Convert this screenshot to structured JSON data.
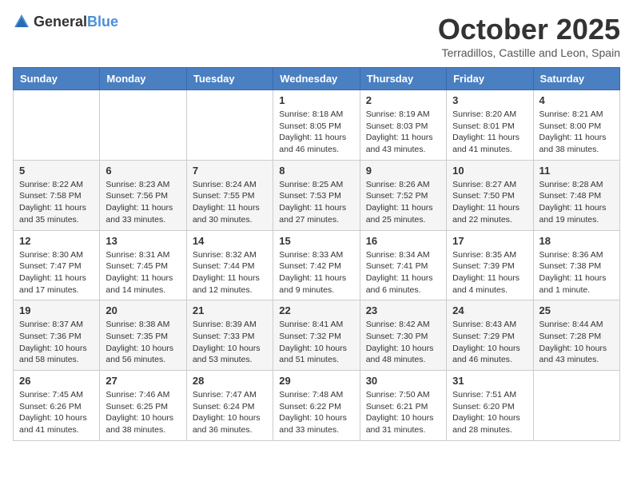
{
  "header": {
    "logo_general": "General",
    "logo_blue": "Blue",
    "month_title": "October 2025",
    "location": "Terradillos, Castille and Leon, Spain"
  },
  "weekdays": [
    "Sunday",
    "Monday",
    "Tuesday",
    "Wednesday",
    "Thursday",
    "Friday",
    "Saturday"
  ],
  "weeks": [
    [
      {
        "day": "",
        "sunrise": "",
        "sunset": "",
        "daylight": ""
      },
      {
        "day": "",
        "sunrise": "",
        "sunset": "",
        "daylight": ""
      },
      {
        "day": "",
        "sunrise": "",
        "sunset": "",
        "daylight": ""
      },
      {
        "day": "1",
        "sunrise": "Sunrise: 8:18 AM",
        "sunset": "Sunset: 8:05 PM",
        "daylight": "Daylight: 11 hours and 46 minutes."
      },
      {
        "day": "2",
        "sunrise": "Sunrise: 8:19 AM",
        "sunset": "Sunset: 8:03 PM",
        "daylight": "Daylight: 11 hours and 43 minutes."
      },
      {
        "day": "3",
        "sunrise": "Sunrise: 8:20 AM",
        "sunset": "Sunset: 8:01 PM",
        "daylight": "Daylight: 11 hours and 41 minutes."
      },
      {
        "day": "4",
        "sunrise": "Sunrise: 8:21 AM",
        "sunset": "Sunset: 8:00 PM",
        "daylight": "Daylight: 11 hours and 38 minutes."
      }
    ],
    [
      {
        "day": "5",
        "sunrise": "Sunrise: 8:22 AM",
        "sunset": "Sunset: 7:58 PM",
        "daylight": "Daylight: 11 hours and 35 minutes."
      },
      {
        "day": "6",
        "sunrise": "Sunrise: 8:23 AM",
        "sunset": "Sunset: 7:56 PM",
        "daylight": "Daylight: 11 hours and 33 minutes."
      },
      {
        "day": "7",
        "sunrise": "Sunrise: 8:24 AM",
        "sunset": "Sunset: 7:55 PM",
        "daylight": "Daylight: 11 hours and 30 minutes."
      },
      {
        "day": "8",
        "sunrise": "Sunrise: 8:25 AM",
        "sunset": "Sunset: 7:53 PM",
        "daylight": "Daylight: 11 hours and 27 minutes."
      },
      {
        "day": "9",
        "sunrise": "Sunrise: 8:26 AM",
        "sunset": "Sunset: 7:52 PM",
        "daylight": "Daylight: 11 hours and 25 minutes."
      },
      {
        "day": "10",
        "sunrise": "Sunrise: 8:27 AM",
        "sunset": "Sunset: 7:50 PM",
        "daylight": "Daylight: 11 hours and 22 minutes."
      },
      {
        "day": "11",
        "sunrise": "Sunrise: 8:28 AM",
        "sunset": "Sunset: 7:48 PM",
        "daylight": "Daylight: 11 hours and 19 minutes."
      }
    ],
    [
      {
        "day": "12",
        "sunrise": "Sunrise: 8:30 AM",
        "sunset": "Sunset: 7:47 PM",
        "daylight": "Daylight: 11 hours and 17 minutes."
      },
      {
        "day": "13",
        "sunrise": "Sunrise: 8:31 AM",
        "sunset": "Sunset: 7:45 PM",
        "daylight": "Daylight: 11 hours and 14 minutes."
      },
      {
        "day": "14",
        "sunrise": "Sunrise: 8:32 AM",
        "sunset": "Sunset: 7:44 PM",
        "daylight": "Daylight: 11 hours and 12 minutes."
      },
      {
        "day": "15",
        "sunrise": "Sunrise: 8:33 AM",
        "sunset": "Sunset: 7:42 PM",
        "daylight": "Daylight: 11 hours and 9 minutes."
      },
      {
        "day": "16",
        "sunrise": "Sunrise: 8:34 AM",
        "sunset": "Sunset: 7:41 PM",
        "daylight": "Daylight: 11 hours and 6 minutes."
      },
      {
        "day": "17",
        "sunrise": "Sunrise: 8:35 AM",
        "sunset": "Sunset: 7:39 PM",
        "daylight": "Daylight: 11 hours and 4 minutes."
      },
      {
        "day": "18",
        "sunrise": "Sunrise: 8:36 AM",
        "sunset": "Sunset: 7:38 PM",
        "daylight": "Daylight: 11 hours and 1 minute."
      }
    ],
    [
      {
        "day": "19",
        "sunrise": "Sunrise: 8:37 AM",
        "sunset": "Sunset: 7:36 PM",
        "daylight": "Daylight: 10 hours and 58 minutes."
      },
      {
        "day": "20",
        "sunrise": "Sunrise: 8:38 AM",
        "sunset": "Sunset: 7:35 PM",
        "daylight": "Daylight: 10 hours and 56 minutes."
      },
      {
        "day": "21",
        "sunrise": "Sunrise: 8:39 AM",
        "sunset": "Sunset: 7:33 PM",
        "daylight": "Daylight: 10 hours and 53 minutes."
      },
      {
        "day": "22",
        "sunrise": "Sunrise: 8:41 AM",
        "sunset": "Sunset: 7:32 PM",
        "daylight": "Daylight: 10 hours and 51 minutes."
      },
      {
        "day": "23",
        "sunrise": "Sunrise: 8:42 AM",
        "sunset": "Sunset: 7:30 PM",
        "daylight": "Daylight: 10 hours and 48 minutes."
      },
      {
        "day": "24",
        "sunrise": "Sunrise: 8:43 AM",
        "sunset": "Sunset: 7:29 PM",
        "daylight": "Daylight: 10 hours and 46 minutes."
      },
      {
        "day": "25",
        "sunrise": "Sunrise: 8:44 AM",
        "sunset": "Sunset: 7:28 PM",
        "daylight": "Daylight: 10 hours and 43 minutes."
      }
    ],
    [
      {
        "day": "26",
        "sunrise": "Sunrise: 7:45 AM",
        "sunset": "Sunset: 6:26 PM",
        "daylight": "Daylight: 10 hours and 41 minutes."
      },
      {
        "day": "27",
        "sunrise": "Sunrise: 7:46 AM",
        "sunset": "Sunset: 6:25 PM",
        "daylight": "Daylight: 10 hours and 38 minutes."
      },
      {
        "day": "28",
        "sunrise": "Sunrise: 7:47 AM",
        "sunset": "Sunset: 6:24 PM",
        "daylight": "Daylight: 10 hours and 36 minutes."
      },
      {
        "day": "29",
        "sunrise": "Sunrise: 7:48 AM",
        "sunset": "Sunset: 6:22 PM",
        "daylight": "Daylight: 10 hours and 33 minutes."
      },
      {
        "day": "30",
        "sunrise": "Sunrise: 7:50 AM",
        "sunset": "Sunset: 6:21 PM",
        "daylight": "Daylight: 10 hours and 31 minutes."
      },
      {
        "day": "31",
        "sunrise": "Sunrise: 7:51 AM",
        "sunset": "Sunset: 6:20 PM",
        "daylight": "Daylight: 10 hours and 28 minutes."
      },
      {
        "day": "",
        "sunrise": "",
        "sunset": "",
        "daylight": ""
      }
    ]
  ]
}
